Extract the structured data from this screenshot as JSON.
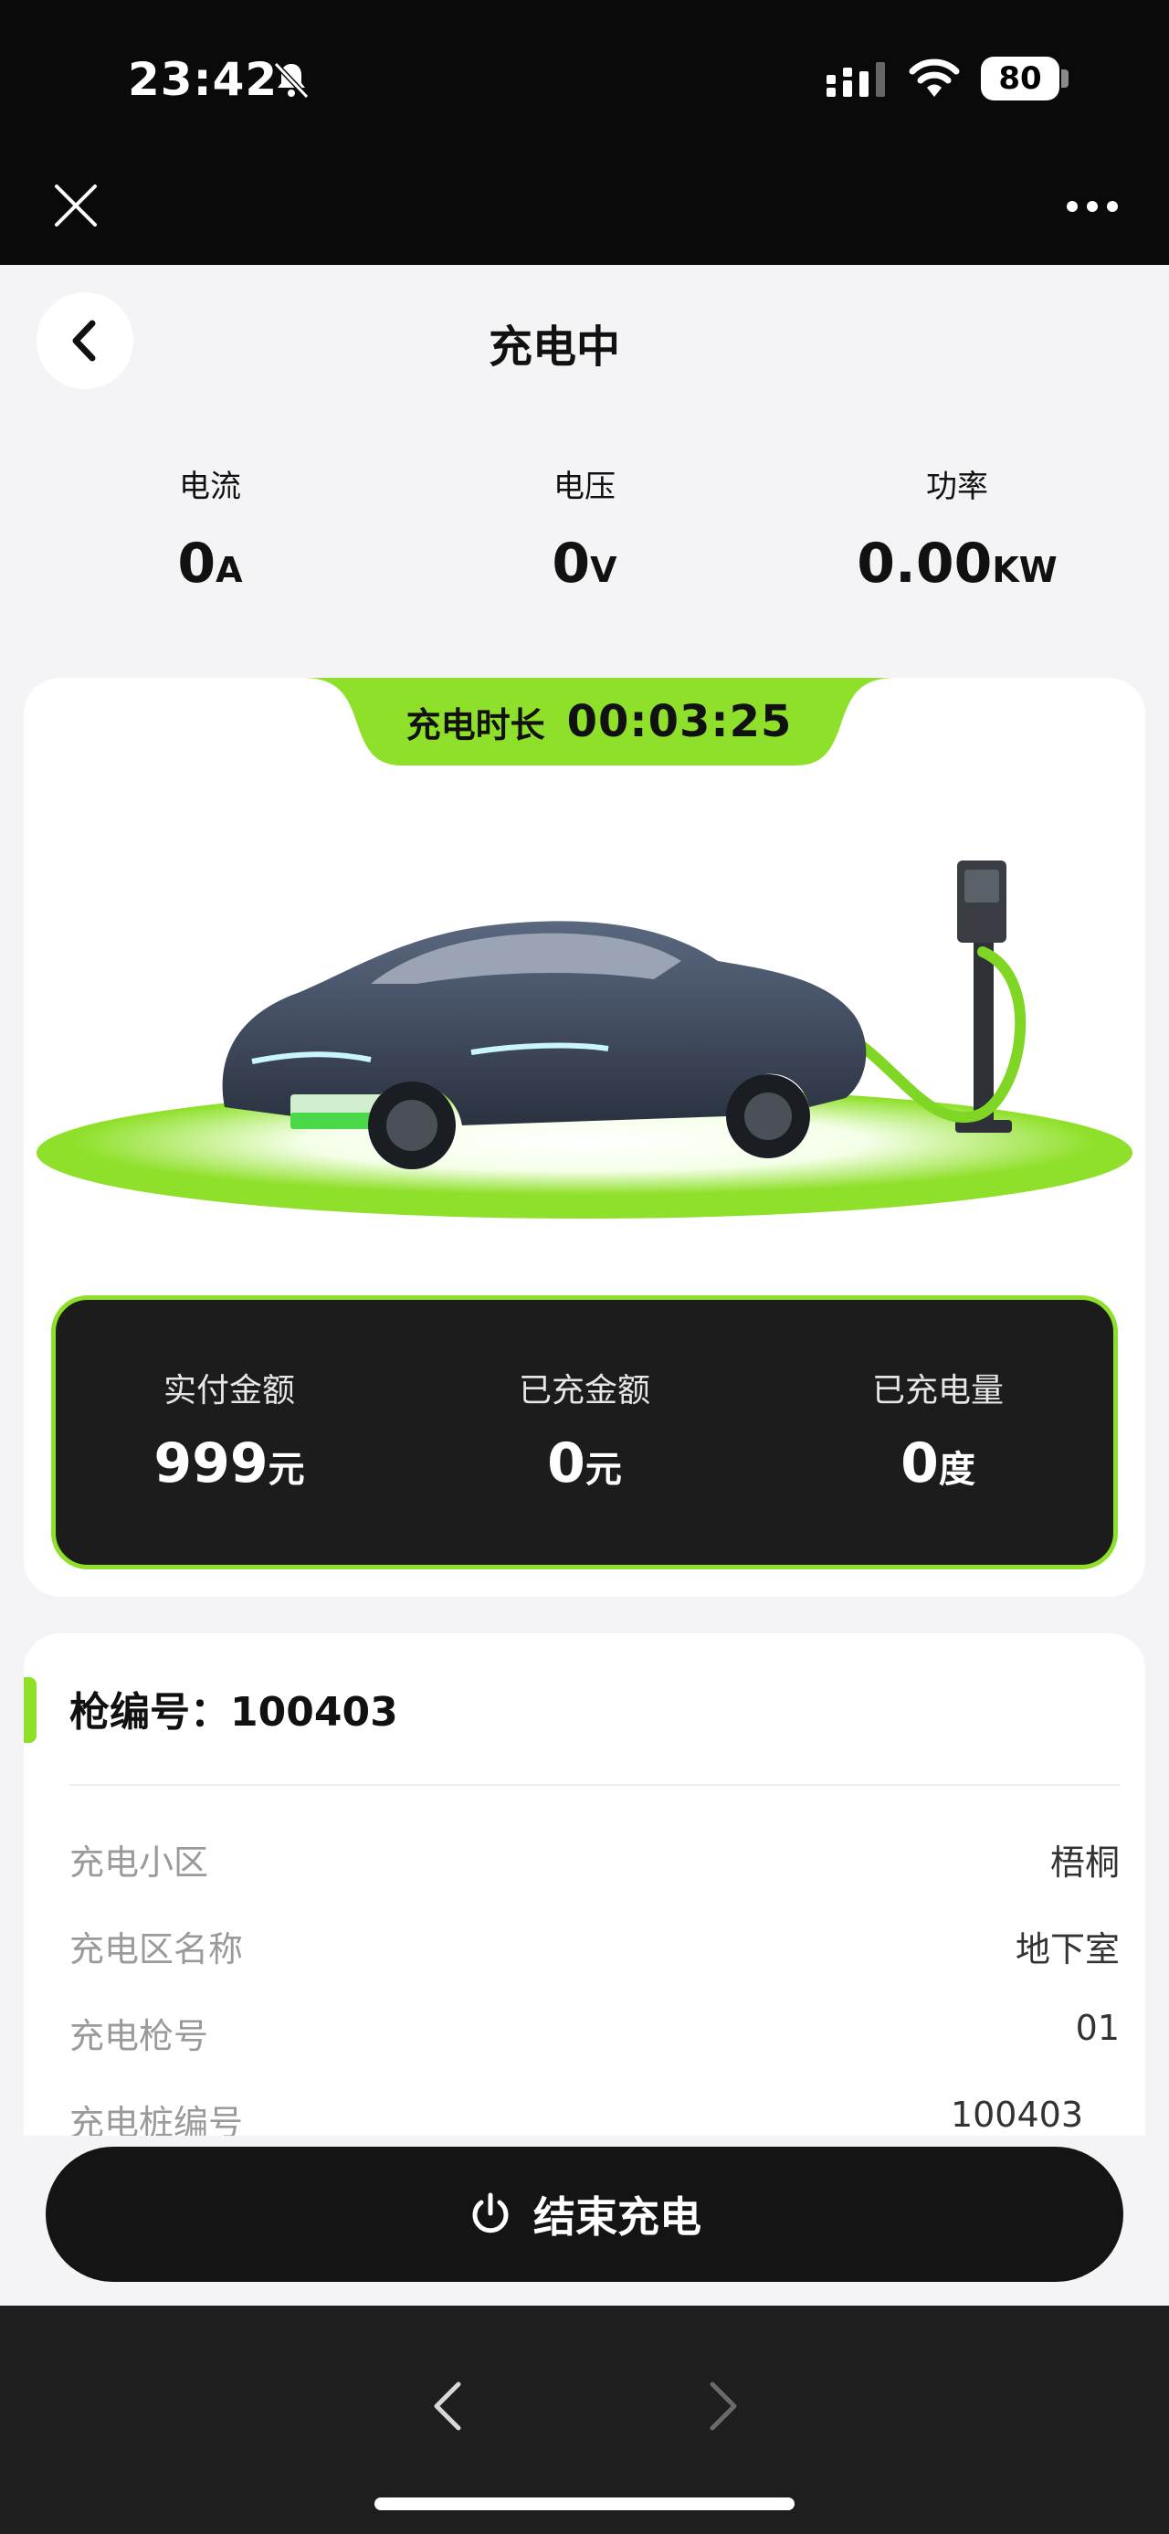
{
  "status_bar": {
    "time": "23:42",
    "battery": "80"
  },
  "header": {
    "title": "充电中"
  },
  "metrics": [
    {
      "label": "电流",
      "value": "0",
      "unit": "A"
    },
    {
      "label": "电压",
      "value": "0",
      "unit": "V"
    },
    {
      "label": "功率",
      "value": "0.00",
      "unit": "KW"
    }
  ],
  "charging": {
    "duration_label": "充电时长",
    "duration": "00:03:25",
    "stats": [
      {
        "label": "实付金额",
        "value": "999",
        "unit": "元"
      },
      {
        "label": "已充金额",
        "value": "0",
        "unit": "元"
      },
      {
        "label": "已充电量",
        "value": "0",
        "unit": "度"
      }
    ]
  },
  "info": {
    "header": "枪编号：100403",
    "rows": [
      {
        "label": "充电小区",
        "value": "梧桐"
      },
      {
        "label": "充电区名称",
        "value": "地下室"
      },
      {
        "label": "充电枪号",
        "value": "01"
      },
      {
        "label": "充电桩编号",
        "value": "100403"
      }
    ]
  },
  "actions": {
    "end_charging": "结束充电"
  },
  "colors": {
    "accent": "#8fe02a",
    "dark": "#1c1c1c",
    "background": "#f4f4f6"
  },
  "icons": [
    "bell-slash-icon",
    "signal-icon",
    "wifi-icon",
    "close-icon",
    "more-icon",
    "back-arrow-icon",
    "power-icon",
    "chevron-left-icon",
    "chevron-right-icon"
  ]
}
